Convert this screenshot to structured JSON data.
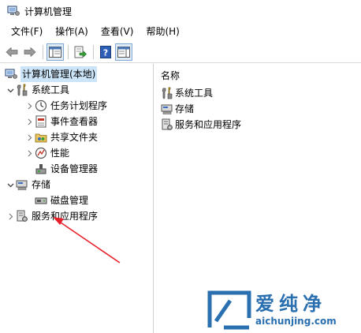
{
  "window": {
    "title": "计算机管理"
  },
  "menu": [
    "文件(F)",
    "操作(A)",
    "查看(V)",
    "帮助(H)"
  ],
  "toolbar": {
    "icons": [
      "back-arrow-icon",
      "forward-arrow-icon",
      "show-hide-console-tree-icon",
      "export-list-icon",
      "help-icon",
      "show-hide-action-pane-icon"
    ]
  },
  "tree": {
    "root": "计算机管理(本地)",
    "system_tools": "系统工具",
    "task_scheduler": "任务计划程序",
    "event_viewer": "事件查看器",
    "shared_folders": "共享文件夹",
    "performance": "性能",
    "device_manager": "设备管理器",
    "storage": "存储",
    "disk_management": "磁盘管理",
    "services_apps": "服务和应用程序"
  },
  "list": {
    "header": "名称",
    "items": [
      "系统工具",
      "存储",
      "服务和应用程序"
    ]
  },
  "watermark": {
    "text": "爱纯净",
    "url": "aichunjing.com"
  },
  "colors": {
    "selection": "#cce4f7",
    "arrow": "#e8202a",
    "watermark": "#2a6fb0"
  }
}
